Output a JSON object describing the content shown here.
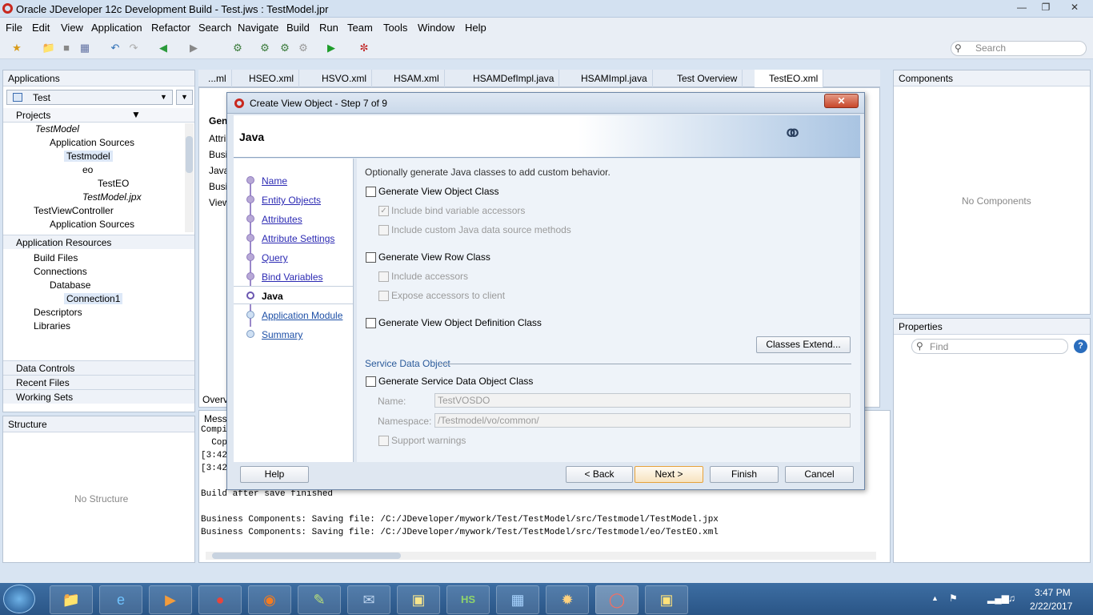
{
  "window": {
    "title": "Oracle JDeveloper 12c Development Build - Test.jws : TestModel.jpr"
  },
  "menu": [
    "File",
    "Edit",
    "View",
    "Application",
    "Refactor",
    "Search",
    "Navigate",
    "Build",
    "Run",
    "Team",
    "Tools",
    "Window",
    "Help"
  ],
  "toolbar": {
    "search_placeholder": "Search"
  },
  "applications": {
    "header": "Applications",
    "selected_app": "Test",
    "projects_label": "Projects",
    "tree": [
      "TestModel",
      "Application Sources",
      "Testmodel",
      "eo",
      "TestEO",
      "TestModel.jpx",
      "TestViewController",
      "Application Sources"
    ],
    "sections": [
      "Application Resources",
      "Data Controls",
      "Recent Files",
      "Working Sets"
    ],
    "resources_tree": [
      "Build Files",
      "Connections",
      "Database",
      "Connection1",
      "Descriptors",
      "Libraries"
    ]
  },
  "structure": {
    "header": "Structure",
    "empty_text": "No Structure"
  },
  "editor_tabs": [
    "...ml",
    "HSEO.xml",
    "HSVO.xml",
    "HSAM.xml",
    "HSAMDefImpl.java",
    "HSAMImpl.java",
    "Test Overview",
    "TestEO.xml"
  ],
  "editor_side": [
    "Gen",
    "Attri",
    "Busin",
    "Java",
    "Busin",
    "View"
  ],
  "editor_bottom_tab": "Overv",
  "messages": {
    "tab": "Mess",
    "lines": [
      "Compi",
      "  Cop",
      "[3:42",
      "[3:42",
      "",
      "Build after save finished",
      "",
      "Business Components: Saving file: /C:/JDeveloper/mywork/Test/TestModel/src/Testmodel/TestModel.jpx",
      "Business Components: Saving file: /C:/JDeveloper/mywork/Test/TestModel/src/Testmodel/eo/TestEO.xml"
    ]
  },
  "components": {
    "header": "Components",
    "empty_text": "No Components"
  },
  "properties": {
    "header": "Properties",
    "find_placeholder": "Find"
  },
  "dialog": {
    "title": "Create View Object - Step 7 of 9",
    "page_title": "Java",
    "steps": [
      "Name",
      "Entity Objects",
      "Attributes",
      "Attribute Settings",
      "Query",
      "Bind Variables",
      "Java",
      "Application Module",
      "Summary"
    ],
    "current_step": "Java",
    "intro": "Optionally generate Java classes to add custom behavior.",
    "options": {
      "view_object_class": "Generate View Object Class",
      "bind_accessors": "Include bind variable accessors",
      "custom_ds": "Include custom Java data source methods",
      "view_row_class": "Generate View Row Class",
      "include_accessors": "Include accessors",
      "expose_accessors": "Expose accessors to client",
      "def_class": "Generate View Object Definition Class"
    },
    "classes_extend": "Classes Extend...",
    "sdo": {
      "section": "Service Data Object",
      "generate": "Generate Service Data Object Class",
      "name_label": "Name:",
      "name_value": "TestVOSDO",
      "namespace_label": "Namespace:",
      "namespace_value": "/Testmodel/vo/common/",
      "support_warnings": "Support warnings"
    },
    "buttons": {
      "help": "Help",
      "back": "< Back",
      "next": "Next >",
      "finish": "Finish",
      "cancel": "Cancel"
    }
  },
  "taskbar": {
    "time": "3:47 PM",
    "date": "2/22/2017"
  }
}
